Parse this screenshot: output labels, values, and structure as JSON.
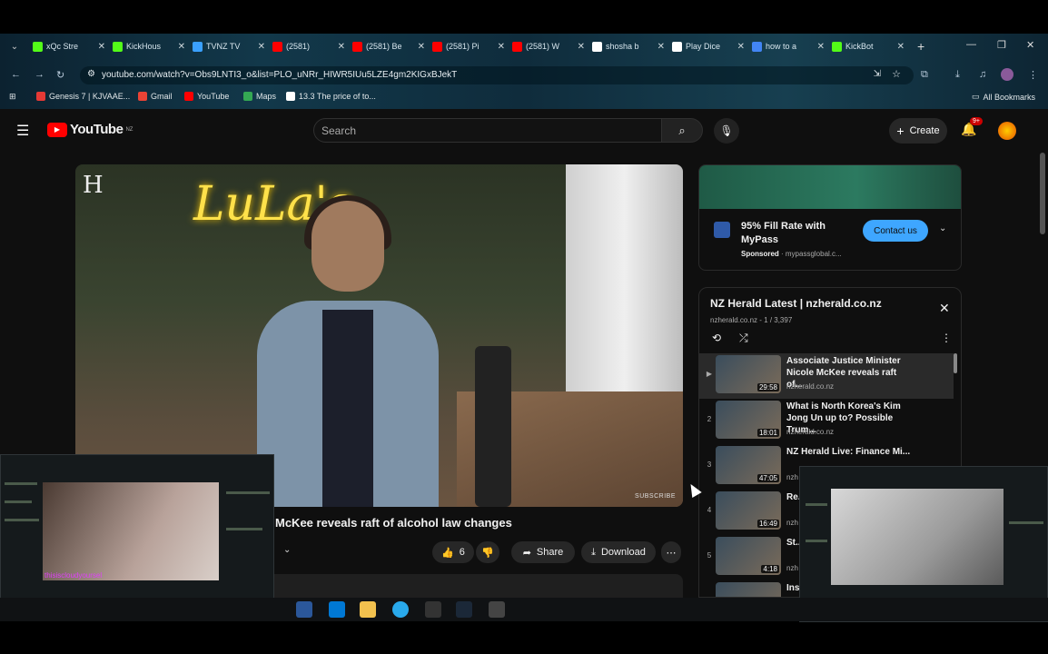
{
  "browser": {
    "tabs": [
      {
        "label": "xQc Stre",
        "color": "#53fc18"
      },
      {
        "label": "KickHous",
        "color": "#53fc18"
      },
      {
        "label": "TVNZ TV",
        "color": "#3aa0ff"
      },
      {
        "label": "(2581)",
        "color": "#ff0000"
      },
      {
        "label": "(2581) Be",
        "color": "#ff0000"
      },
      {
        "label": "(2581) Pi",
        "color": "#ff0000"
      },
      {
        "label": "(2581) W",
        "color": "#ff0000"
      },
      {
        "label": "shosha b",
        "color": "#ffffff"
      },
      {
        "label": "Play Dice",
        "color": "#ffffff"
      },
      {
        "label": "how to a",
        "color": "#4285f4"
      },
      {
        "label": "KickBot",
        "color": "#53fc18"
      }
    ],
    "url": "youtube.com/watch?v=Obs9LNTI3_o&list=PLO_uNRr_HIWR5IUu5LZE4gm2KIGxBJekT",
    "bookmarks": [
      {
        "label": "Genesis 7 | KJVAAE...",
        "color": "#e53935"
      },
      {
        "label": "Gmail",
        "color": "#ea4335"
      },
      {
        "label": "YouTube",
        "color": "#ff0000"
      },
      {
        "label": "Maps",
        "color": "#34a853"
      },
      {
        "label": "13.3 The price of to...",
        "color": "#ffffff"
      }
    ],
    "all_bookmarks": "All Bookmarks"
  },
  "youtube": {
    "logo": "YouTube",
    "region": "NZ",
    "search_placeholder": "Search",
    "create_label": "Create",
    "notif_count": "9+"
  },
  "video": {
    "sign_text": "LuLa's",
    "brand": "H",
    "watermark": "SUBSCRIBE",
    "title": "McKee reveals raft of alcohol law changes",
    "like_count": "6",
    "share_label": "Share",
    "download_label": "Download"
  },
  "ad": {
    "title": "95% Fill Rate with MyPass",
    "sponsored": "Sponsored",
    "domain": "mypassglobal.c...",
    "cta": "Contact us"
  },
  "playlist": {
    "title": "NZ Herald Latest | nzherald.co.nz",
    "channel": "nzherald.co.nz",
    "position": "1 / 3,397",
    "items": [
      {
        "num": "▶",
        "title": "Associate Justice Minister Nicole McKee reveals raft of...",
        "channel": "nzherald.co.nz",
        "duration": "29:58"
      },
      {
        "num": "2",
        "title": "What is North Korea's Kim Jong Un up to? Possible Trum...",
        "channel": "nzherald.co.nz",
        "duration": "18:01"
      },
      {
        "num": "3",
        "title": "NZ Herald Live: Finance Mi...",
        "channel": "nzh",
        "duration": "47:05"
      },
      {
        "num": "4",
        "title": "Re... exp...",
        "channel": "nzh",
        "duration": "16:49"
      },
      {
        "num": "5",
        "title": "St... Po...",
        "channel": "nzh",
        "duration": "4:18"
      },
      {
        "num": "6",
        "title": "Ins...",
        "channel": "",
        "duration": ""
      }
    ]
  },
  "overlay_left": {
    "username": "thisiscloudyoursel"
  }
}
